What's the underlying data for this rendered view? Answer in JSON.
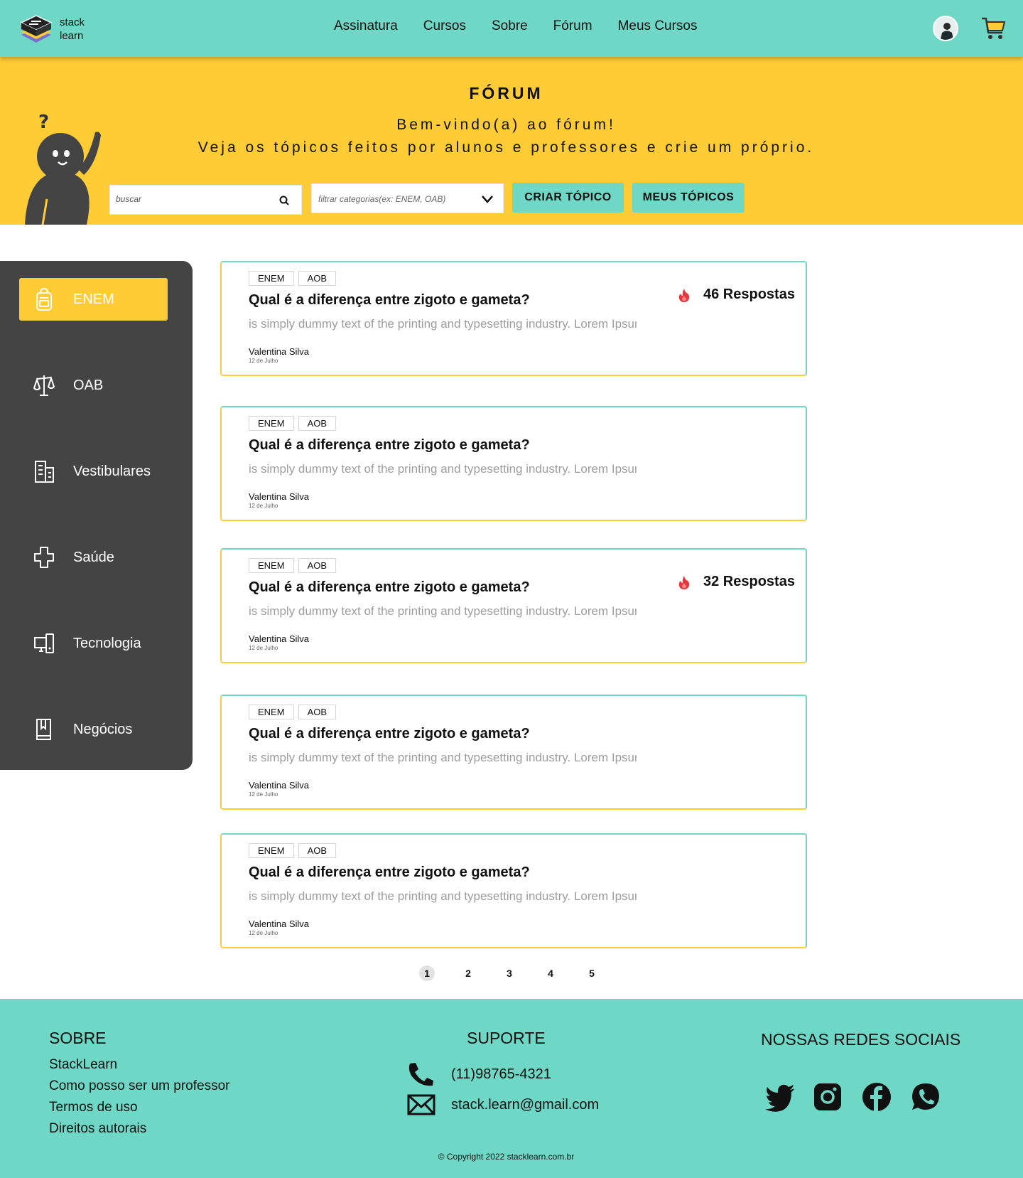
{
  "brand": {
    "line1": "stack",
    "line2": "learn"
  },
  "nav": [
    "Assinatura",
    "Cursos",
    "Sobre",
    "Fórum",
    "Meus Cursos"
  ],
  "hero": {
    "title": "FÓRUM",
    "subtitle1": "Bem-vindo(a) ao fórum!",
    "subtitle2": "Veja os tópicos feitos por alunos e professores e crie um próprio.",
    "search_placeholder": "buscar",
    "filter_placeholder": "filtrar categorias(ex: ENEM, OAB)",
    "btn_create": "CRIAR TÓPICO",
    "btn_mine": "MEUS TÓPICOS"
  },
  "sidebar": [
    {
      "label": "ENEM",
      "icon": "backpack-icon",
      "active": true
    },
    {
      "label": "OAB",
      "icon": "scales-icon",
      "active": false
    },
    {
      "label": "Vestibulares",
      "icon": "building-icon",
      "active": false
    },
    {
      "label": "Saúde",
      "icon": "medical-cross-icon",
      "active": false
    },
    {
      "label": "Tecnologia",
      "icon": "devices-icon",
      "active": false
    },
    {
      "label": "Negócios",
      "icon": "book-icon",
      "active": false
    }
  ],
  "topics": [
    {
      "tags": [
        "ENEM",
        "AOB"
      ],
      "title": "Qual é a diferença entre zigoto e gameta?",
      "body": "is simply dummy text of the printing and typesetting industry. Lorem Ipsum has been the industry's standard dummy text ever since the",
      "author": "Valentina Silva",
      "date": "12 de Julho",
      "replies": "46 Respostas"
    },
    {
      "tags": [
        "ENEM",
        "AOB"
      ],
      "title": "Qual é a diferença entre zigoto e gameta?",
      "body": "is simply dummy text of the printing and typesetting industry. Lorem Ipsum has been the industry's standard dummy text ever since the",
      "author": "Valentina Silva",
      "date": "12 de Julho",
      "replies": ""
    },
    {
      "tags": [
        "ENEM",
        "AOB"
      ],
      "title": "Qual é a diferença entre zigoto e gameta?",
      "body": "is simply dummy text of the printing and typesetting industry. Lorem Ipsum has been the industry's standard dummy text ever since the",
      "author": "Valentina Silva",
      "date": "12 de Julho",
      "replies": "32 Respostas"
    },
    {
      "tags": [
        "ENEM",
        "AOB"
      ],
      "title": "Qual é a diferença entre zigoto e gameta?",
      "body": "is simply dummy text of the printing and typesetting industry. Lorem Ipsum has been the industry's standard dummy text ever since the",
      "author": "Valentina Silva",
      "date": "12 de Julho",
      "replies": ""
    },
    {
      "tags": [
        "ENEM",
        "AOB"
      ],
      "title": "Qual é a diferença entre zigoto e gameta?",
      "body": "is simply dummy text of the printing and typesetting industry. Lorem Ipsum has been the industry's standard dummy text ever since the",
      "author": "Valentina Silva",
      "date": "12 de Julho",
      "replies": ""
    }
  ],
  "pagination": {
    "pages": [
      "1",
      "2",
      "3",
      "4",
      "5"
    ],
    "current": "1"
  },
  "footer": {
    "about_heading": "SOBRE",
    "about_links": [
      "StackLearn",
      "Como posso ser um professor",
      "Termos de uso",
      "Direitos autorais"
    ],
    "support_heading": "SUPORTE",
    "phone": "(11)98765-4321",
    "email": "stack.learn@gmail.com",
    "social_heading": "NOSSAS REDES SOCIAIS",
    "social": [
      "twitter-icon",
      "instagram-icon",
      "facebook-icon",
      "whatsapp-icon"
    ],
    "copyright": "© Copyright 2022 stacklearn.com.br"
  },
  "colors": {
    "teal": "#6fd7c6",
    "yellow": "#ffcc36",
    "dark": "#444444",
    "fire": "#e8383d"
  }
}
